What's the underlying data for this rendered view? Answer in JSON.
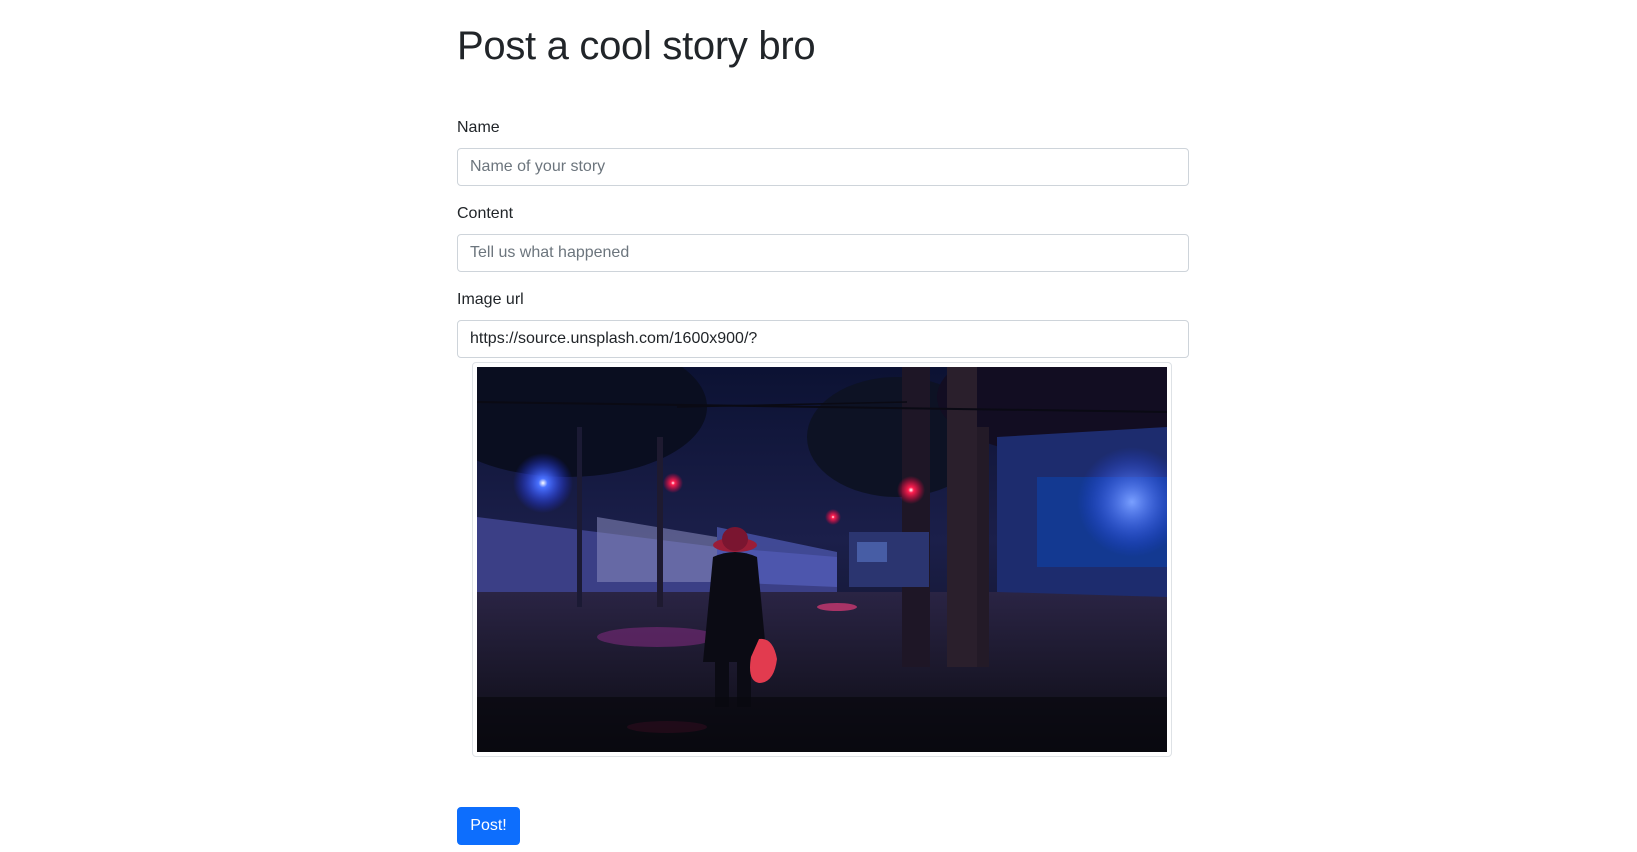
{
  "page": {
    "title": "Post a cool story bro"
  },
  "form": {
    "name": {
      "label": "Name",
      "placeholder": "Name of your story",
      "value": ""
    },
    "content": {
      "label": "Content",
      "placeholder": "Tell us what happened",
      "value": ""
    },
    "image_url": {
      "label": "Image url",
      "placeholder": "",
      "value": "https://source.unsplash.com/1600x900/?"
    },
    "submit_label": "Post!"
  },
  "colors": {
    "primary": "#0d6efd",
    "border": "#ced4da",
    "text": "#212529",
    "placeholder": "#6c757d"
  }
}
